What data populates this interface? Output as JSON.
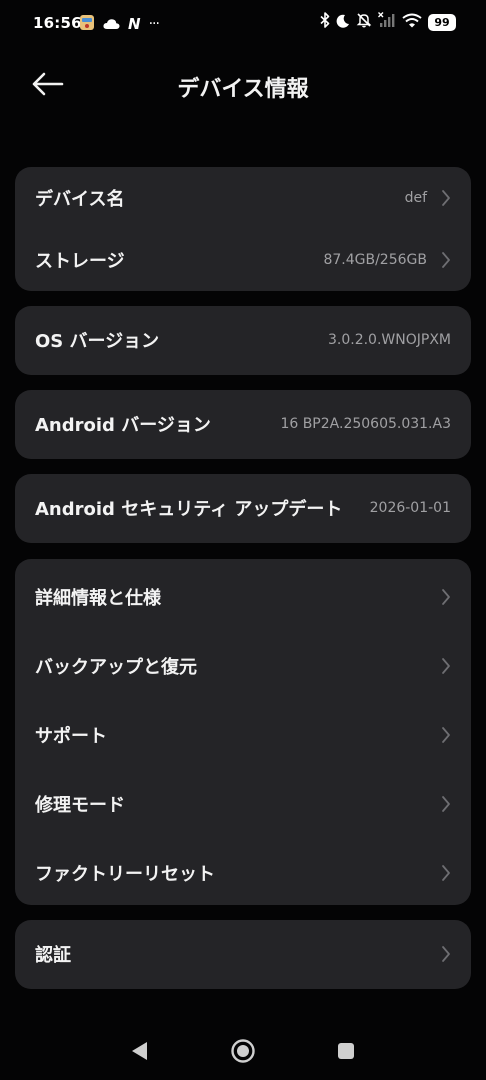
{
  "status_bar": {
    "time": "16:56",
    "left_icons": [
      "notification-app-icon",
      "cloud-icon",
      "n-app-icon",
      "more-dots-icon"
    ],
    "more_dots": "···",
    "n_glyph": "N",
    "right_icons": [
      "bluetooth-icon",
      "moon-icon",
      "bell-off-icon",
      "no-signal-icon",
      "wifi-icon"
    ],
    "battery": "99"
  },
  "header": {
    "title": "デバイス情報"
  },
  "cards": {
    "device": {
      "name_label": "デバイス名",
      "name_value": "def",
      "storage_label": "ストレージ",
      "storage_value": "87.4GB/256GB"
    },
    "os_version": {
      "label": "OS バージョン",
      "value": "3.0.2.0.WNOJPXM"
    },
    "android_version": {
      "label": "Android バージョン",
      "value": "16 BP2A.250605.031.A3"
    },
    "security_update": {
      "label": "Android セキュリティ アップデート",
      "value": "2026-01-01"
    },
    "menu": {
      "items": [
        {
          "label": "詳細情報と仕様"
        },
        {
          "label": "バックアップと復元"
        },
        {
          "label": "サポート"
        },
        {
          "label": "修理モード"
        },
        {
          "label": "ファクトリーリセット"
        }
      ]
    },
    "certification": {
      "label": "認証"
    }
  },
  "colors": {
    "background": "#040405",
    "card": "#242427",
    "label": "#f3f3f3",
    "value": "#a0a0a3",
    "chevron": "#6e6e72"
  }
}
